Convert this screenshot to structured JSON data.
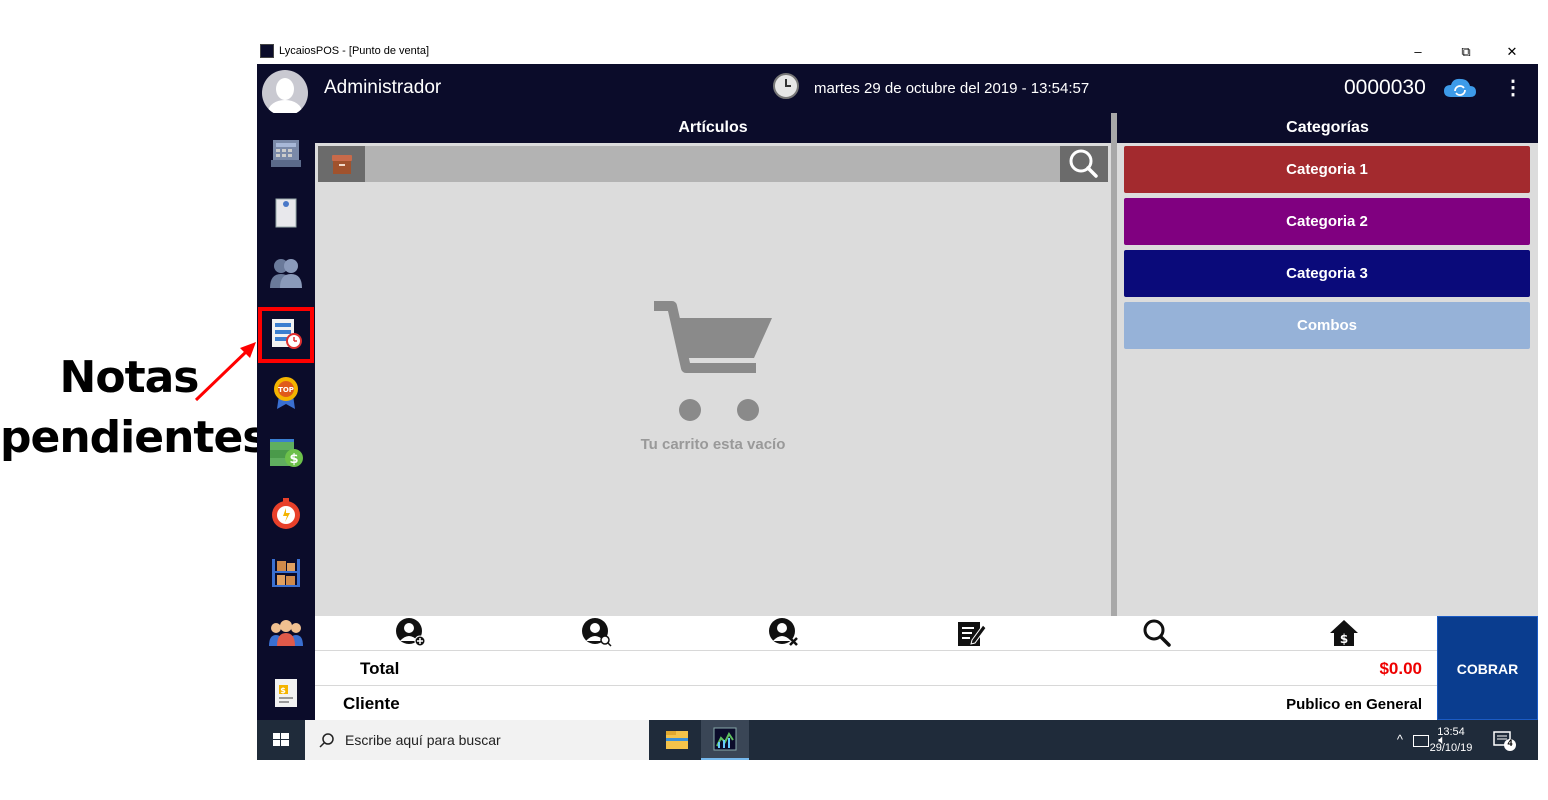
{
  "annotation": {
    "line1": "Notas",
    "line2": "pendientes",
    "color": "#ff0000"
  },
  "window": {
    "title": "LycaiosPOS - [Punto de venta]",
    "minimize": "–",
    "maximize": "⧉",
    "close": "✕"
  },
  "header": {
    "user": "Administrador",
    "datetime": "martes 29 de octubre del 2019 - 13:54:57",
    "ticket_number": "0000030",
    "menu_icon": "kebab-icon",
    "sync_icon": "cloud-sync-icon"
  },
  "sidebar": {
    "items": [
      {
        "icon": "cash-register-icon"
      },
      {
        "icon": "notepad-icon"
      },
      {
        "icon": "users-icon"
      },
      {
        "icon": "pending-notes-icon"
      },
      {
        "icon": "top-badge-icon"
      },
      {
        "icon": "money-icon"
      },
      {
        "icon": "stopwatch-icon"
      },
      {
        "icon": "warehouse-shelf-icon"
      },
      {
        "icon": "employees-icon"
      },
      {
        "icon": "report-icon"
      }
    ]
  },
  "articles": {
    "header": "Artículos",
    "empty_text": "Tu carrito esta vacío"
  },
  "categories": {
    "header": "Categorías",
    "items": [
      {
        "label": "Categoria 1",
        "color": "#a32a2e"
      },
      {
        "label": "Categoria 2",
        "color": "#800080"
      },
      {
        "label": "Categoria 3",
        "color": "#0a0a7a"
      },
      {
        "label": "Combos",
        "color": "#96b2d8"
      }
    ]
  },
  "actions": [
    "add-client-icon",
    "search-client-icon",
    "remove-client-icon",
    "edit-note-icon",
    "search-icon",
    "home-money-icon"
  ],
  "totals": {
    "total_label": "Total",
    "total_value": "$0.00",
    "client_label": "Cliente",
    "client_value": "Publico en General",
    "cobrar_label": "COBRAR"
  },
  "taskbar": {
    "search_placeholder": "Escribe aquí para buscar",
    "time": "13:54",
    "date": "29/10/19",
    "notifications": "4",
    "tray": "^"
  }
}
